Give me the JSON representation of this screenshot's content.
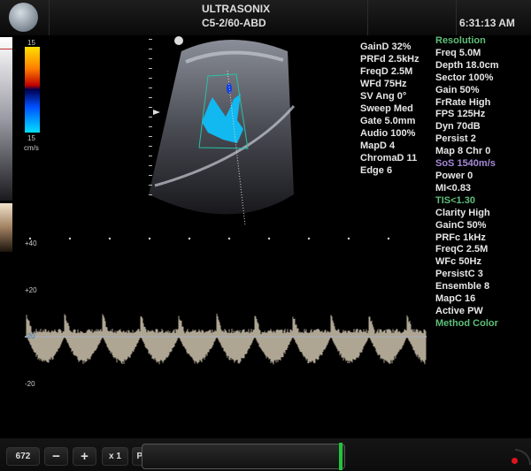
{
  "header": {
    "brand": "ULTRASONIX",
    "probe_preset": "C5-2/60-ABD",
    "time": "6:31:13 AM"
  },
  "color_bar": {
    "top_label": "15",
    "bottom_label": "15",
    "unit": "cm/s"
  },
  "doppler_params": [
    "GainD 32%",
    "PRFd 2.5kHz",
    "FreqD 2.5M",
    "WFd 75Hz",
    "SV Ang 0°",
    "Sweep Med",
    "Gate 5.0mm",
    "Audio 100%",
    "MapD 4",
    "ChromaD 11",
    "Edge 6"
  ],
  "imaging_params": [
    {
      "text": "Resolution",
      "color": "green"
    },
    {
      "text": "Freq 5.0M"
    },
    {
      "text": "Depth 18.0cm"
    },
    {
      "text": "Sector 100%"
    },
    {
      "text": "Gain 50%"
    },
    {
      "text": "FrRate High"
    },
    {
      "text": "FPS 125Hz"
    },
    {
      "text": "Dyn 70dB"
    },
    {
      "text": "Persist 2"
    },
    {
      "text": "Map 8   Chr 0"
    },
    {
      "text": "SoS 1540m/s",
      "color": "purple"
    },
    {
      "text": "Power 0"
    },
    {
      "text": "MI<0.83"
    },
    {
      "text": "TIS<1.30",
      "color": "green"
    },
    {
      "text": "Clarity High"
    },
    {
      "text": "GainC 50%"
    },
    {
      "text": "PRFc 1kHz"
    },
    {
      "text": "FreqC 2.5M"
    },
    {
      "text": "WFc 50Hz"
    },
    {
      "text": "PersistC 3"
    },
    {
      "text": "Ensemble 8"
    },
    {
      "text": "MapC 16"
    },
    {
      "text": "Active PW"
    },
    {
      "text": "Method Color",
      "color": "green"
    }
  ],
  "spectral_scale": {
    "p40": "+40",
    "p20": "+20",
    "baseline": "-20",
    "m20": "-20"
  },
  "toolbar": {
    "counter": "672",
    "minus": "−",
    "plus": "+",
    "zoom": "x 1",
    "mode": "PW"
  },
  "cine_progress": 0.99,
  "colors": {
    "green": "#5fbf7a",
    "purple": "#a58ad8",
    "progress_marker": "#22c43a",
    "status_dot": "#e0141c"
  }
}
